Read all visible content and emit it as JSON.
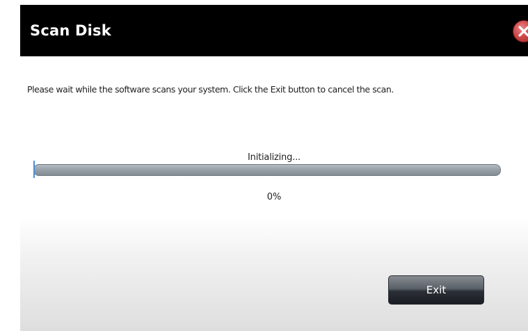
{
  "dialog": {
    "title": "Scan Disk",
    "close_icon": "close-x-icon",
    "message": "Please wait while the software scans your system. Click the Exit button to cancel the scan.",
    "status": "Initializing...",
    "progress_percent": 0,
    "progress_label": "0%",
    "exit_label": "Exit"
  },
  "colors": {
    "titlebar": "#000000",
    "close_button": "#cf4b4b",
    "progress_track": "#9aa2a9",
    "progress_fill": "#4f8fd6",
    "exit_button": "#3a3f45"
  }
}
